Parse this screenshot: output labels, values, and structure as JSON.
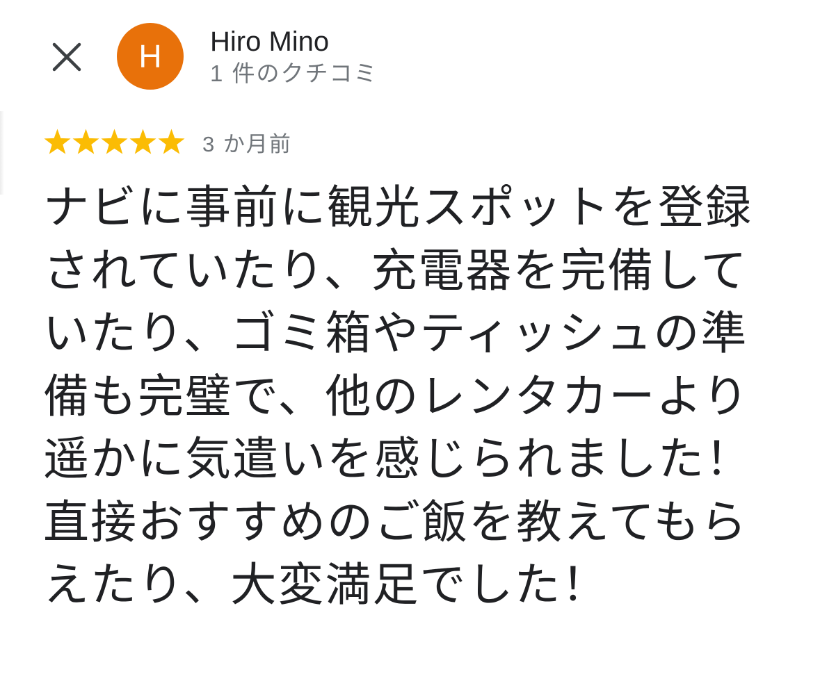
{
  "header": {
    "close_icon": "close-icon",
    "avatar_initial": "H",
    "avatar_color": "#e8710a",
    "reviewer_name": "Hiro Mino",
    "reviewer_review_count": "1 件のクチコミ"
  },
  "review": {
    "rating": 5,
    "rating_max": 5,
    "star_color": "#fbbc04",
    "date": "3 か月前",
    "text": "ナビに事前に観光スポットを登録されていたり、充電器を完備していたり、ゴミ箱やティッシュの準備も完璧で、他のレンタカーより遥かに気遣いを感じられました！直接おすすめのご飯を教えてもらえたり、大変満足でした！"
  }
}
